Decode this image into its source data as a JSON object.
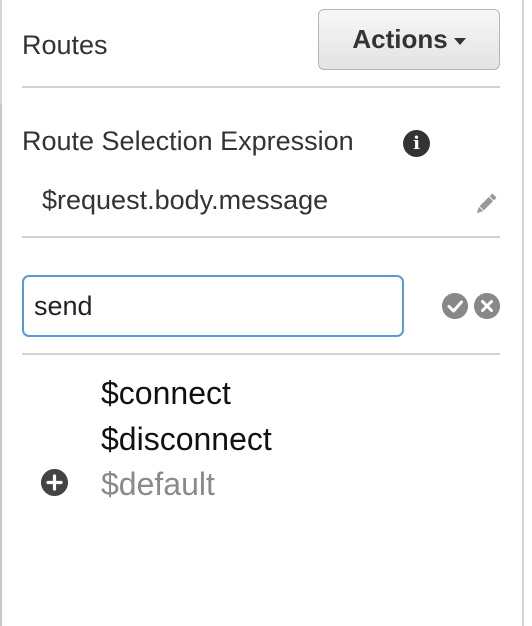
{
  "header": {
    "title": "Routes",
    "actions_label": "Actions"
  },
  "route_selection": {
    "label": "Route Selection Expression",
    "value": "$request.body.message"
  },
  "new_route_input": {
    "value": "send"
  },
  "routes": [
    {
      "label": "$connect",
      "muted": false
    },
    {
      "label": "$disconnect",
      "muted": false
    },
    {
      "label": "$default",
      "muted": true
    }
  ],
  "icons": {
    "info": "info-icon",
    "edit": "pencil-icon",
    "confirm": "check-circle-icon",
    "cancel": "x-circle-icon",
    "add": "plus-circle-icon",
    "dropdown": "caret-down-icon"
  },
  "colors": {
    "input_focus_border": "#5b9bd5",
    "muted_text": "#8a8a8a",
    "icon_gray": "#888888"
  }
}
